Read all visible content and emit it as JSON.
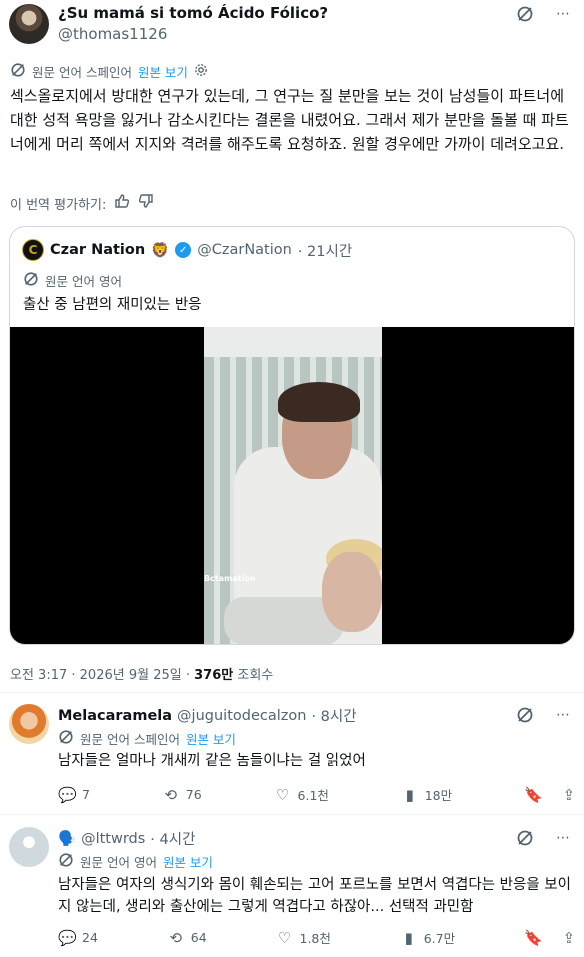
{
  "main_post": {
    "author_name": "¿Su mamá si tomó Ácido Fólico?",
    "handle": "@thomas1126",
    "translated_from": "원문 언어 스페인어",
    "view_original": "원본 보기",
    "body": "섹스올로지에서 방대한 연구가 있는데, 그 연구는 질 분만을 보는 것이 남성들이 파트너에 대한 성적 욕망을 잃거나 감소시킨다는 결론을 내렸어요. 그래서 제가 분만을 돌볼 때 파트너에게 머리 쪽에서 지지와 격려를 해주도록 요청하죠. 원할 경우에만 가까이 데려오고요.",
    "rate_translation": "이 번역 평가하기:"
  },
  "quote": {
    "name": "Czar Nation",
    "name_emoji": "🦁",
    "handle": "@CzarNation",
    "time": "· 21시간",
    "translated_from": "원문 언어 영어",
    "body": "출산 중 남편의 재미있는 반응",
    "video_watermark": "Bctamation"
  },
  "meta": {
    "time": "오전 3:17",
    "date": "· 2026년 9월 25일 ·",
    "views": "376만",
    "views_label": "조회수"
  },
  "replies": [
    {
      "name": "Melacaramela",
      "handle": "@juguitodecalzon",
      "time": "· 8시간",
      "translated_from": "원문 언어 스페인어",
      "view_original": "원본 보기",
      "body": "남자들은 얼마나 개새끼 같은 놈들이냐는 걸 읽었어",
      "replies": "7",
      "reposts": "76",
      "likes": "6.1천",
      "views": "18만"
    },
    {
      "name": "🗣️",
      "handle": "@lttwrds",
      "time": "· 4시간",
      "translated_from": "원문 언어 영어",
      "view_original": "원본 보기",
      "body": "남자들은 여자의 생식기와 몸이 훼손되는 고어 포르노를 보면서 역겹다는 반응을 보이지 않는데, 생리와 출산에는 그렇게 역겹다고 하잖아... 선택적 과민함",
      "replies": "24",
      "reposts": "64",
      "likes": "1.8천",
      "views": "6.7만"
    }
  ],
  "colors": {
    "accent": "#1d9bf0",
    "muted": "#536471",
    "border": "#cfd9de"
  }
}
